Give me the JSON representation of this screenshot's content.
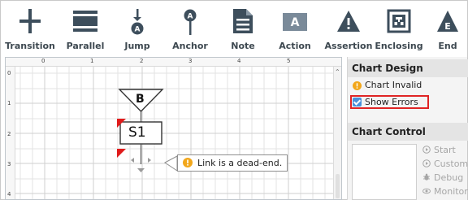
{
  "toolbar": {
    "items": [
      {
        "label": "Transition",
        "icon": "transition-icon"
      },
      {
        "label": "Parallel",
        "icon": "parallel-icon"
      },
      {
        "label": "Jump",
        "icon": "jump-icon"
      },
      {
        "label": "Anchor",
        "icon": "anchor-icon"
      },
      {
        "label": "Note",
        "icon": "note-icon"
      },
      {
        "label": "Action",
        "icon": "action-icon"
      },
      {
        "label": "Assertion",
        "icon": "assertion-icon"
      },
      {
        "label": "Enclosing",
        "icon": "enclosing-icon"
      },
      {
        "label": "End",
        "icon": "end-icon"
      }
    ],
    "icon_color": "#3d4e5c",
    "action_icon_color": "#7a8a99"
  },
  "canvas": {
    "ruler_top": [
      "0",
      "1",
      "2",
      "3",
      "4",
      "5"
    ],
    "ruler_left": [
      "0",
      "1",
      "2",
      "3",
      "4"
    ],
    "jump_label": "B",
    "step_label": "S1",
    "error_marker_color": "#e01b1b",
    "tooltip": "Link is a dead-end."
  },
  "chart_design": {
    "title": "Chart Design",
    "status": "Chart Invalid",
    "show_errors_label": "Show Errors",
    "show_errors_checked": true
  },
  "chart_control": {
    "title": "Chart Control",
    "buttons": [
      {
        "label": "Start",
        "icon": "play-icon"
      },
      {
        "label": "Custom",
        "icon": "play-icon"
      },
      {
        "label": "Debug",
        "icon": "bug-icon"
      },
      {
        "label": "Monitor",
        "icon": "eye-icon"
      }
    ]
  },
  "colors": {
    "warning": "#f2a71b",
    "accent": "#4a90d9",
    "highlight_border": "#e02424"
  }
}
